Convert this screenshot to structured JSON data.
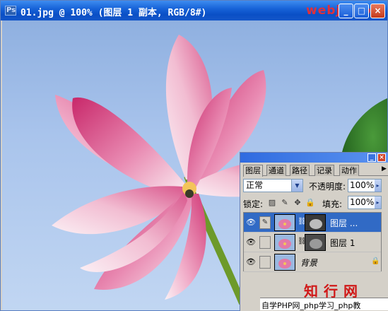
{
  "window": {
    "title": "01.jpg @ 100% (图层 1 副本, RGB/8#)",
    "watermark": "webjx.com",
    "controls": {
      "minimize": "_",
      "maximize": "□",
      "close": "×"
    }
  },
  "layers_panel": {
    "tabs": [
      "图层",
      "通道",
      "路径",
      "记录",
      "动作"
    ],
    "blend_mode": "正常",
    "opacity_label": "不透明度:",
    "opacity_value": "100%",
    "lock_label": "锁定:",
    "fill_label": "填充:",
    "fill_value": "100%",
    "layers": [
      {
        "name": "图层 ...",
        "selected": true,
        "has_mask": true
      },
      {
        "name": "图层 1",
        "selected": false,
        "has_mask": true
      },
      {
        "name": "背景",
        "selected": false,
        "has_mask": false,
        "locked": true
      }
    ]
  },
  "watermark_bottom": "知行网",
  "bottom_strip_text": "自学PHP网_php学习_php教",
  "colors": {
    "titlebar": "#1456c8",
    "selected_layer": "#316ac5",
    "watermark": "#e0303a"
  }
}
